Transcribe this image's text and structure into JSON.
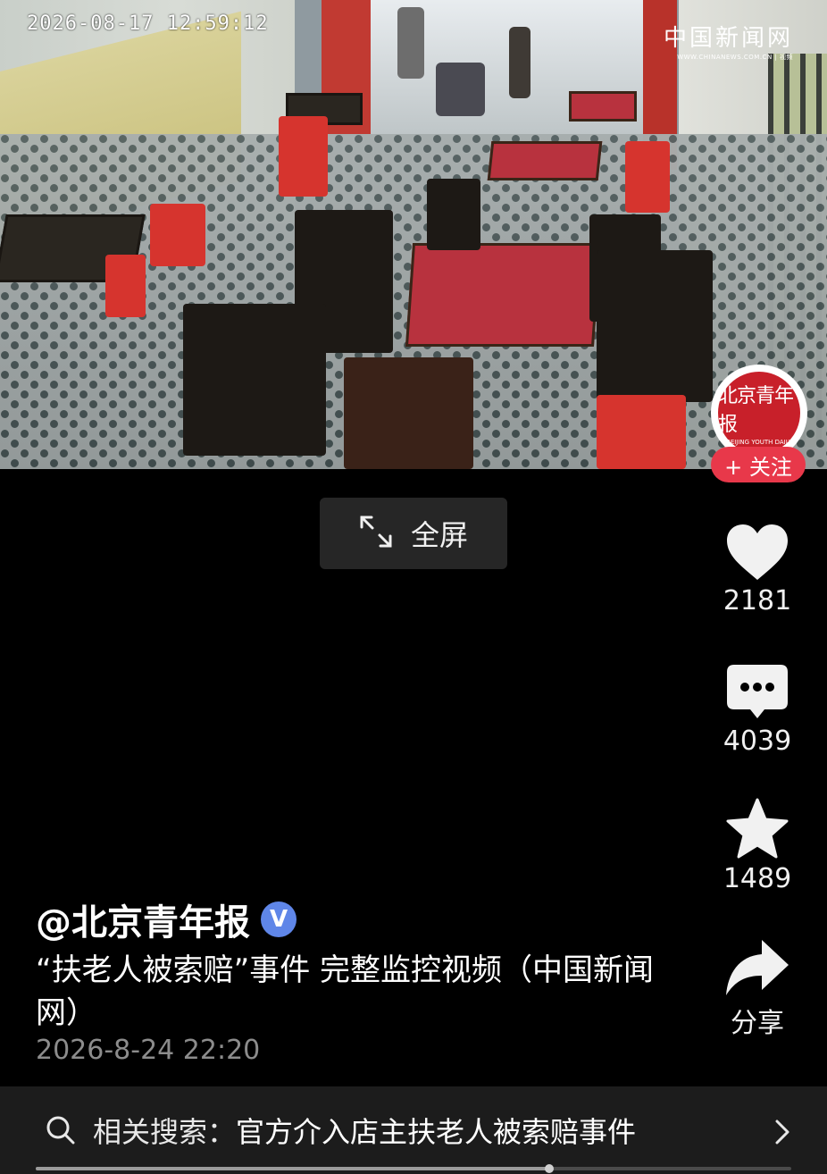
{
  "video": {
    "timestamp": "2026-08-17  12:59:12",
    "watermark_title": "中国新闻网",
    "watermark_sub": "WWW.CHINANEWS.COM.CN | 视频"
  },
  "fullscreen": {
    "label": "全屏"
  },
  "account": {
    "avatar_cn": "北京青年报",
    "avatar_en": "BEIJING YOUTH DAILY",
    "follow_label": "+ 关注"
  },
  "actions": {
    "like_count": "2181",
    "comment_count": "4039",
    "favorite_count": "1489",
    "share_label": "分享"
  },
  "post": {
    "author": "@北京青年报",
    "verified_mark": "V",
    "caption": "“扶老人被索赔”事件 完整监控视频（中国新闻网）",
    "date": "2026-8-24 22:20"
  },
  "related": {
    "label": "相关搜索：",
    "query": "官方介入店主扶老人被索赔事件"
  },
  "playback": {
    "progress_fraction": 0.68
  },
  "colors": {
    "follow_red": "#e8384a",
    "verified_blue": "#5f86e8",
    "background": "#000000"
  }
}
